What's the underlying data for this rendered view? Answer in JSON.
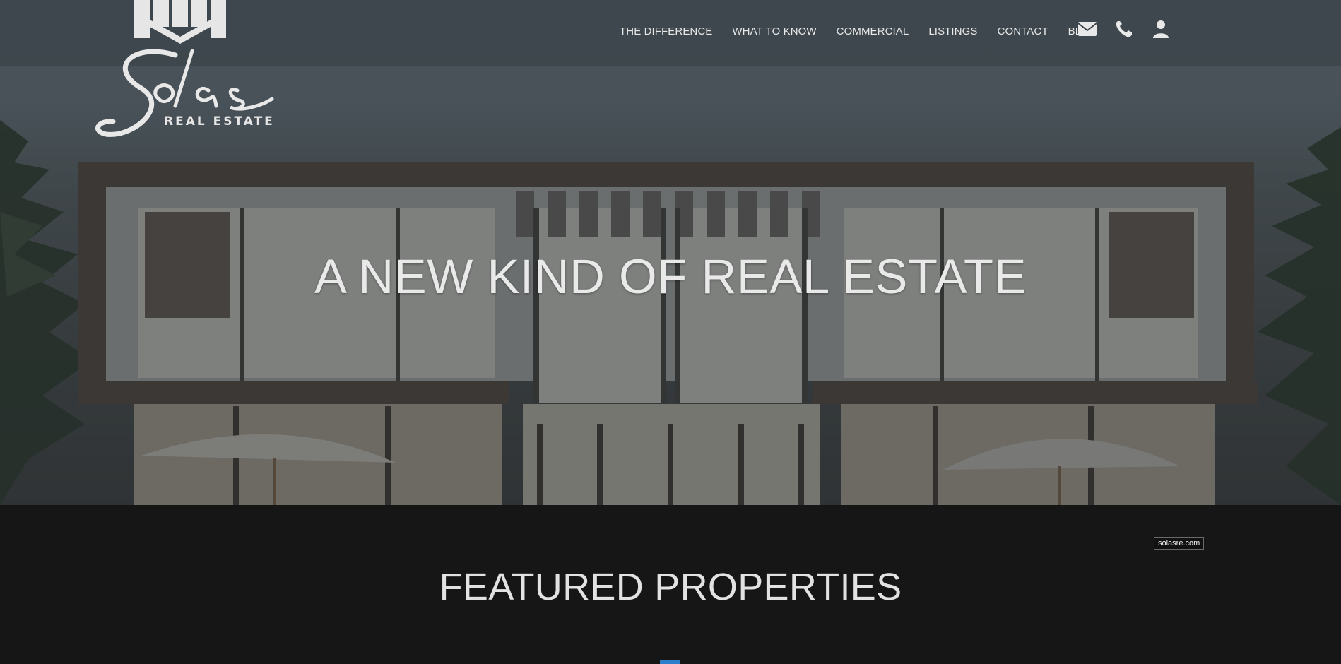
{
  "brand": {
    "script_name": "Solas",
    "tagline": "REAL ESTATE"
  },
  "nav": {
    "items": [
      {
        "label": "THE DIFFERENCE"
      },
      {
        "label": "WHAT TO KNOW"
      },
      {
        "label": "COMMERCIAL"
      },
      {
        "label": "LISTINGS"
      },
      {
        "label": "CONTACT"
      },
      {
        "label": "BLOG"
      }
    ],
    "icons": [
      "envelope-icon",
      "phone-icon",
      "user-icon"
    ]
  },
  "hero": {
    "headline": "A NEW KIND OF REAL ESTATE"
  },
  "featured": {
    "domain_label": "solasre.com",
    "title": "FEATURED PROPERTIES"
  },
  "colors": {
    "accent": "#2d7ecb",
    "nav_text": "#e8e8e8",
    "section_bg": "#161616"
  }
}
